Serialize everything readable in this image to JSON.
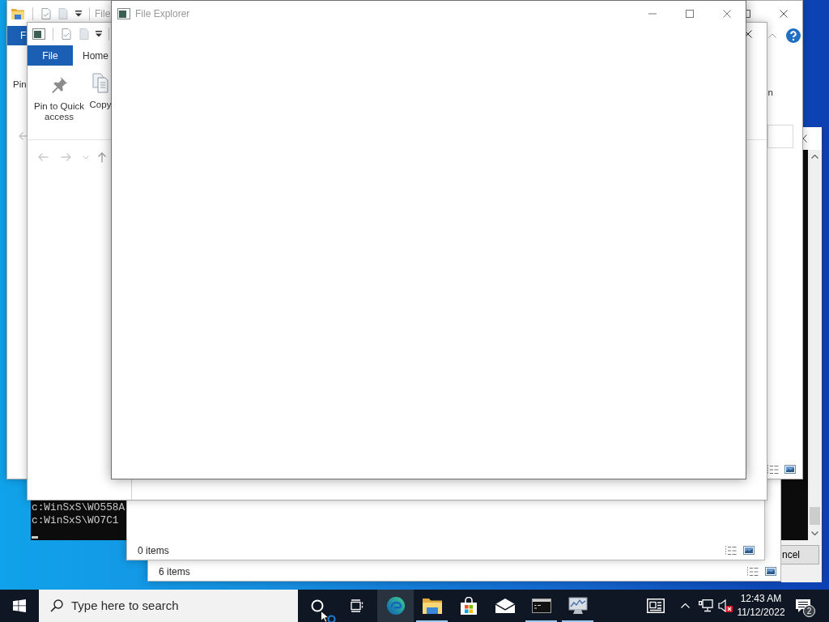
{
  "console_window": {
    "lines": [
      "c:WinSxS\\WO558A",
      "c:WinSxS\\WO7C1"
    ]
  },
  "explorer_back": {
    "status": "6 items"
  },
  "dialog": {
    "button": "ncel"
  },
  "explorer_middle": {
    "status": "0 items"
  },
  "explorer_ribbon_back": {
    "title": "File",
    "tabs": [
      {
        "kind": "file_menu",
        "label": "F"
      }
    ],
    "ribbon_button": "Pin",
    "ribbon_fragment": "n"
  },
  "explorer_ribbon_front": {
    "tabs": [
      {
        "kind": "file_menu",
        "label": "File"
      },
      {
        "kind": "tab",
        "label": "Home"
      }
    ],
    "ribbon_buttons": [
      {
        "kind": "pin",
        "label": "Pin to Quick access"
      },
      {
        "kind": "copy",
        "label": "Copy"
      }
    ]
  },
  "front_window": {
    "title": "File Explorer"
  },
  "taskbar": {
    "search": {
      "placeholder": "Type here to search"
    },
    "apps": [
      {
        "kind": "browser",
        "running": false,
        "highlighted": true
      },
      {
        "kind": "folder",
        "running": true,
        "highlighted": false
      },
      {
        "kind": "store",
        "running": false,
        "highlighted": false
      },
      {
        "kind": "mail",
        "running": false,
        "highlighted": false
      },
      {
        "kind": "terminal",
        "running": true,
        "highlighted": false
      },
      {
        "kind": "monitor",
        "running": true,
        "highlighted": false
      }
    ],
    "tray": {
      "volume": {
        "muted": true
      },
      "clock": {
        "time": "12:43 AM",
        "date": "11/12/2022"
      },
      "notifications": {
        "count": "2"
      }
    }
  }
}
